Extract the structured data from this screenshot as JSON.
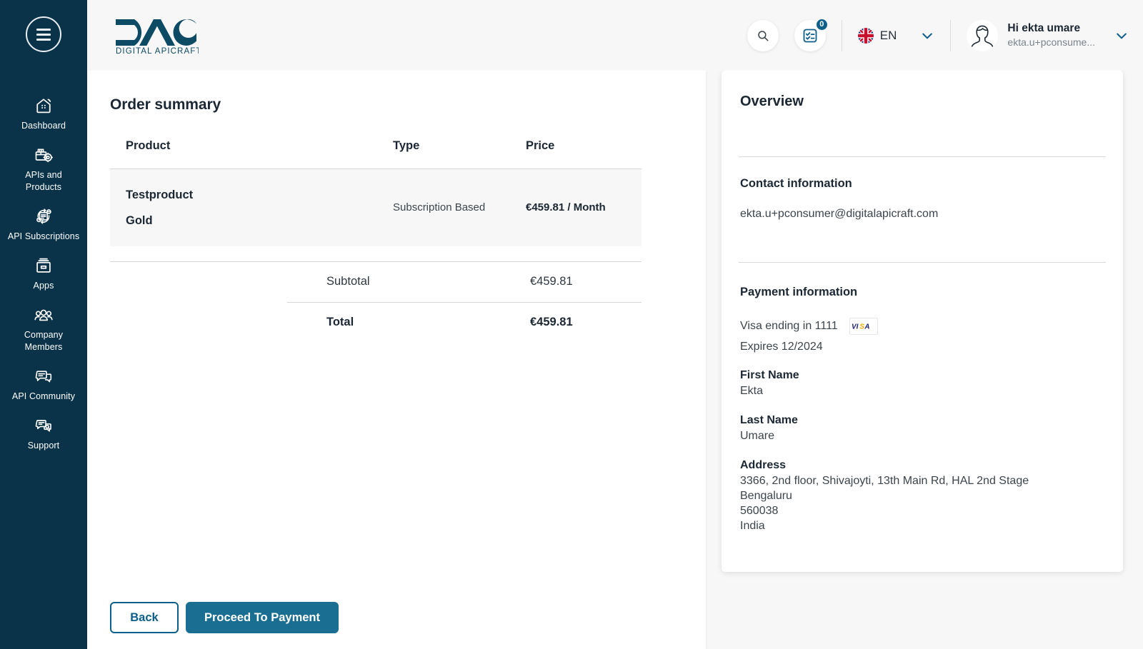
{
  "brand": {
    "logo_text": "DAC",
    "logo_tagline": "DIGITAL APICRAFT",
    "sidebar_color": "#0a3349",
    "accent_color": "#1a6e92",
    "link_color": "#0b5f8a"
  },
  "sidebar": {
    "menu_toggle_name": "hamburger-menu-icon",
    "items": [
      {
        "label": "Dashboard",
        "icon": "dashboard-icon"
      },
      {
        "label": "APIs and Products",
        "icon": "apis-products-icon"
      },
      {
        "label": "API Subscriptions",
        "icon": "api-subscriptions-icon"
      },
      {
        "label": "Apps",
        "icon": "apps-icon"
      },
      {
        "label": "Company Members",
        "icon": "company-members-icon"
      },
      {
        "label": "API Community",
        "icon": "api-community-icon"
      },
      {
        "label": "Support",
        "icon": "support-icon"
      }
    ]
  },
  "topbar": {
    "search_icon": "search-icon",
    "tasks_icon": "checklist-icon",
    "tasks_badge": "0",
    "language": {
      "flag": "uk-flag-icon",
      "code": "EN",
      "chevron": "chevron-down-icon"
    },
    "user": {
      "avatar": "user-avatar-icon",
      "greeting": "Hi ekta umare",
      "email": "ekta.u+pconsume...",
      "chevron": "chevron-down-icon"
    }
  },
  "order_summary": {
    "title": "Order summary",
    "columns": [
      "Product",
      "Type",
      "Price"
    ],
    "rows": [
      {
        "product_name": "Testproduct",
        "product_tier": "Gold",
        "type": "Subscription Based",
        "price": "€459.81 / Month"
      }
    ],
    "totals": [
      {
        "label": "Subtotal",
        "value": "€459.81"
      },
      {
        "label": "Total",
        "value": "€459.81"
      }
    ]
  },
  "overview": {
    "title": "Overview",
    "contact": {
      "heading": "Contact information",
      "email": "ekta.u+pconsumer@digitalapicraft.com"
    },
    "payment": {
      "heading": "Payment information",
      "card_text": "Visa ending in 1111",
      "card_brand": "VISA",
      "expires": "Expires 12/2024",
      "fields": [
        {
          "label": "First Name",
          "value": "Ekta"
        },
        {
          "label": "Last Name",
          "value": "Umare"
        },
        {
          "label": "Address",
          "value": "3366, 2nd floor, Shivajoyti, 13th Main Rd, HAL 2nd Stage\nBengaluru\n560038\nIndia"
        }
      ]
    }
  },
  "actions": {
    "back": "Back",
    "proceed": "Proceed To Payment"
  }
}
